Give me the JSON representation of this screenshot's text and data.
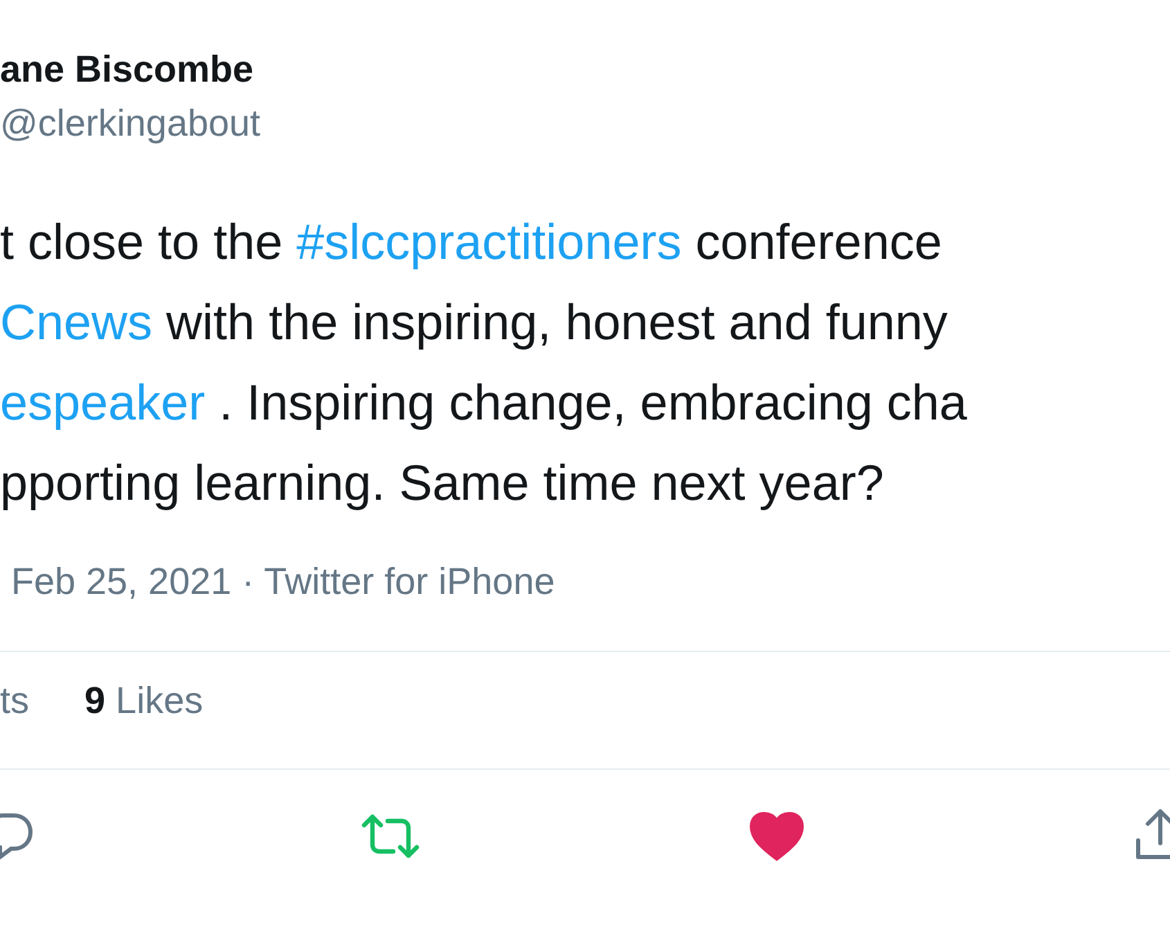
{
  "author": {
    "name": "ane Biscombe",
    "handle": "@clerkingabout"
  },
  "tweet_lines": [
    [
      {
        "kind": "text",
        "text": "t close to the "
      },
      {
        "kind": "link",
        "text": "#slccpractitioners"
      },
      {
        "kind": "text",
        "text": " conference"
      }
    ],
    [
      {
        "kind": "link",
        "text": "Cnews"
      },
      {
        "kind": "text",
        "text": " with the inspiring, honest and funny"
      }
    ],
    [
      {
        "kind": "link",
        "text": "espeaker"
      },
      {
        "kind": "text",
        "text": " . Inspiring change, embracing cha"
      }
    ],
    [
      {
        "kind": "text",
        "text": "pporting learning. Same time next year?"
      }
    ]
  ],
  "meta": "Feb 25, 2021 · Twitter for iPhone",
  "stats": [
    {
      "text": "ts"
    },
    {
      "text": "**9** Likes"
    }
  ],
  "actions": {
    "retweeted": true,
    "liked": true
  }
}
